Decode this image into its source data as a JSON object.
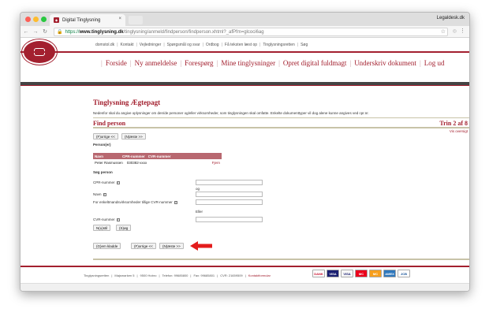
{
  "browser": {
    "tab_title": "Digital Tinglysning",
    "tab_close": "×",
    "profile_name": "Legaldesk.dk",
    "url_secure": "https://",
    "url_host": "www.tinglysning.dk",
    "url_path": "/tinglysning/anmeld/findperson/findperson.xhtml?_afPfm=glcoci6ag"
  },
  "toplinks": [
    "domstol.dk",
    "Kontakt",
    "Vejledninger",
    "Spørgsmål og svar",
    "Ordbog",
    "Få teksten læst op",
    "Tinglysningsretten",
    "Søg"
  ],
  "nav": [
    "Forside",
    "Ny anmeldelse",
    "Forespørg",
    "Mine tinglysninger",
    "Opret digital fuldmagt",
    "Underskriv dokument",
    "Log ud"
  ],
  "content": {
    "title": "Tinglysning Ægtepagt",
    "desc": "Nedenfor skal du angive oplysninger om den/de personer og/eller virksomheder, som tinglysningen skal omfatte. Enkelte dokumenttyper vil dog alene kunne angives ved cpr.nr.",
    "section_title": "Find person",
    "step": "Trin 2 af 8",
    "overview_link": "Vis oversigt"
  },
  "buttons": {
    "prev": "(F)orrige <<",
    "next": "(N)æste >>",
    "clear": "N(u)stil",
    "search": "(S)øg",
    "save_draft": "(G)em kladde",
    "prev2": "(F)orrige <<",
    "next2": "(N)æste >>"
  },
  "persons": {
    "heading": "Person(er)",
    "columns": [
      "Navn",
      "CPR-nummer",
      "CVR-nummer"
    ],
    "rows": [
      {
        "name": "Peter Rasmussen",
        "cpr": "030382-xxxx",
        "cvr": "",
        "action": "Fjern"
      }
    ]
  },
  "search": {
    "heading": "Søg person",
    "cpr_label": "CPR-nummer",
    "or1": "og",
    "name_label": "Navn",
    "company_label": "For enkeltmandsvirksomheder tillige CVR-nummer",
    "or2": "Eller",
    "cvr_label": "CVR-nummer"
  },
  "footer": {
    "items": [
      "Tinglysningsretten",
      "Majsmarken 5",
      "9500 Hobro",
      "Telefon: 99685800",
      "Fax: 99685801",
      "CVR: 21659509"
    ],
    "contact": "Kontaktformular",
    "cards": [
      "DANK",
      "VISA",
      "VISA",
      "MC",
      "MC",
      "AMEX",
      "JCB"
    ]
  },
  "colors": {
    "brand": "#a3202f",
    "arrow": "#e31c1c"
  }
}
